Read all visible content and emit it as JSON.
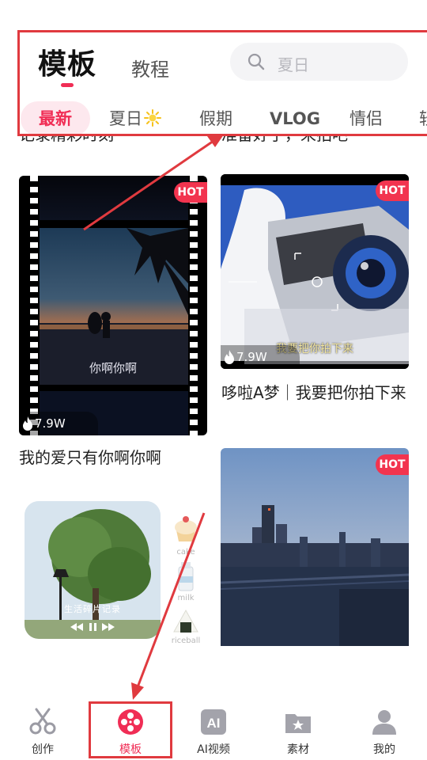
{
  "header": {
    "tabs": [
      {
        "label": "模板",
        "active": true
      },
      {
        "label": "教程",
        "active": false
      }
    ],
    "search": {
      "placeholder": "夏日",
      "icon": "search-icon"
    }
  },
  "categories": [
    {
      "label": "最新",
      "active": true
    },
    {
      "label": "夏日",
      "icon": "sun-icon"
    },
    {
      "label": "假期"
    },
    {
      "label": "VLOG"
    },
    {
      "label": "情侣"
    },
    {
      "label": "轻"
    }
  ],
  "clipped_titles": [
    "记录精彩时刻",
    "准备好了，来拍吧"
  ],
  "cards": [
    {
      "badge": "HOT",
      "views": "7.9W",
      "subtitle": "你啊你啊",
      "title": "我的爱只有你啊你啊"
    },
    {
      "badge": "HOT",
      "views": "7.9W",
      "caption": "我要把你拍下来",
      "title": "哆啦A梦｜我要把你拍下来"
    },
    {
      "badge": "HOT"
    }
  ],
  "stickers": [
    "cake",
    "milk",
    "riceball"
  ],
  "tree_overlay": "生活碎片记录",
  "bottom_nav": [
    {
      "label": "创作",
      "icon": "scissors-icon"
    },
    {
      "label": "模板",
      "icon": "film-reel-icon",
      "active": true
    },
    {
      "label": "AI视频",
      "icon": "ai-icon"
    },
    {
      "label": "素材",
      "icon": "folder-star-icon"
    },
    {
      "label": "我的",
      "icon": "user-icon"
    }
  ],
  "colors": {
    "accent": "#f02d55",
    "annotation": "#e03a3f",
    "hot_badge": "#f2344f"
  }
}
